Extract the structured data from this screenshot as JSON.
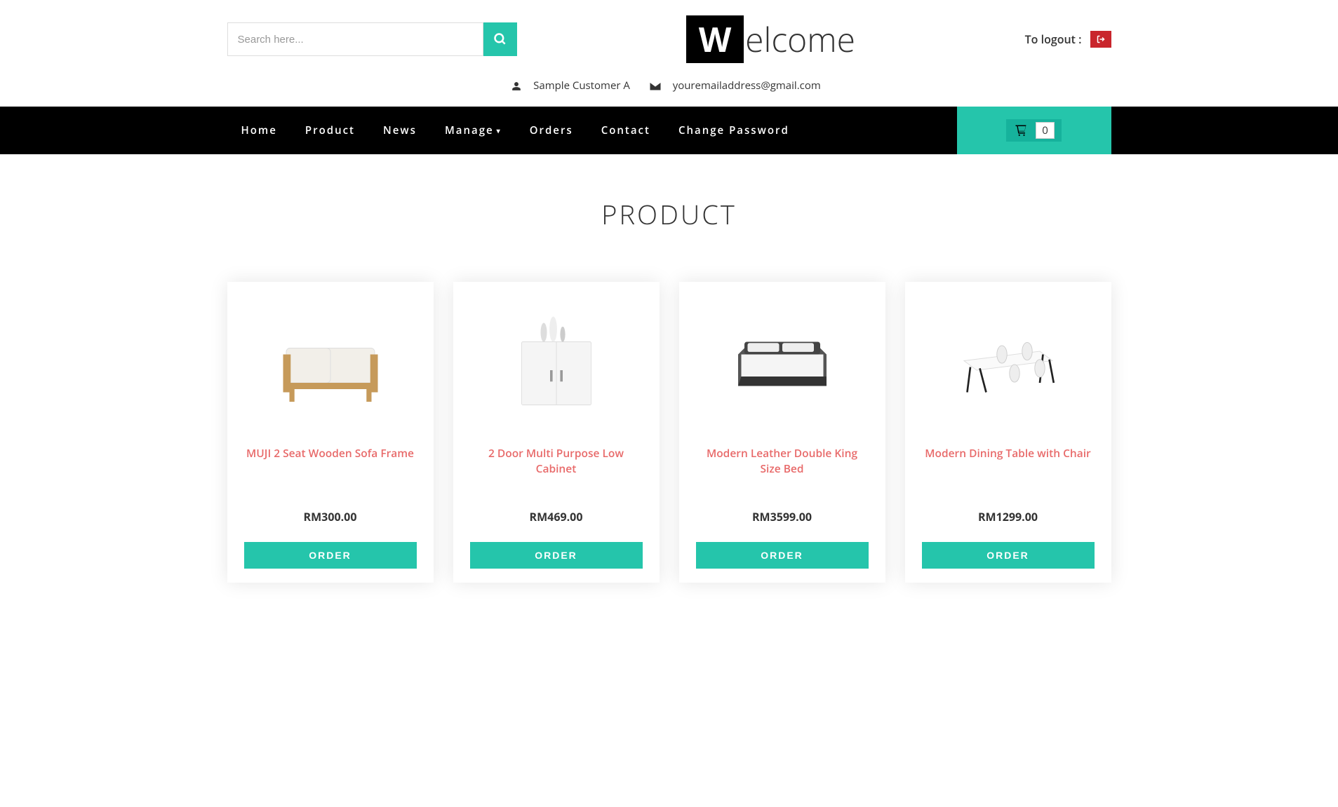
{
  "search": {
    "placeholder": "Search here..."
  },
  "logo": {
    "prefix": "W",
    "suffix": "elcome"
  },
  "logout": {
    "label": "To logout :"
  },
  "user": {
    "name": "Sample Customer A",
    "email": "youremailaddress@gmail.com"
  },
  "nav": {
    "items": [
      {
        "label": "Home"
      },
      {
        "label": "Product"
      },
      {
        "label": "News"
      },
      {
        "label": "Manage",
        "dropdown": true
      },
      {
        "label": "Orders"
      },
      {
        "label": "Contact"
      },
      {
        "label": "Change Password"
      }
    ]
  },
  "cart": {
    "count": "0"
  },
  "page": {
    "title": "PRODUCT"
  },
  "products": [
    {
      "name": "MUJI 2 Seat Wooden Sofa Frame",
      "price": "RM300.00",
      "order": "ORDER"
    },
    {
      "name": "2 Door Multi Purpose Low Cabinet",
      "price": "RM469.00",
      "order": "ORDER"
    },
    {
      "name": "Modern Leather Double King Size Bed",
      "price": "RM3599.00",
      "order": "ORDER"
    },
    {
      "name": "Modern Dining Table with Chair",
      "price": "RM1299.00",
      "order": "ORDER"
    }
  ]
}
